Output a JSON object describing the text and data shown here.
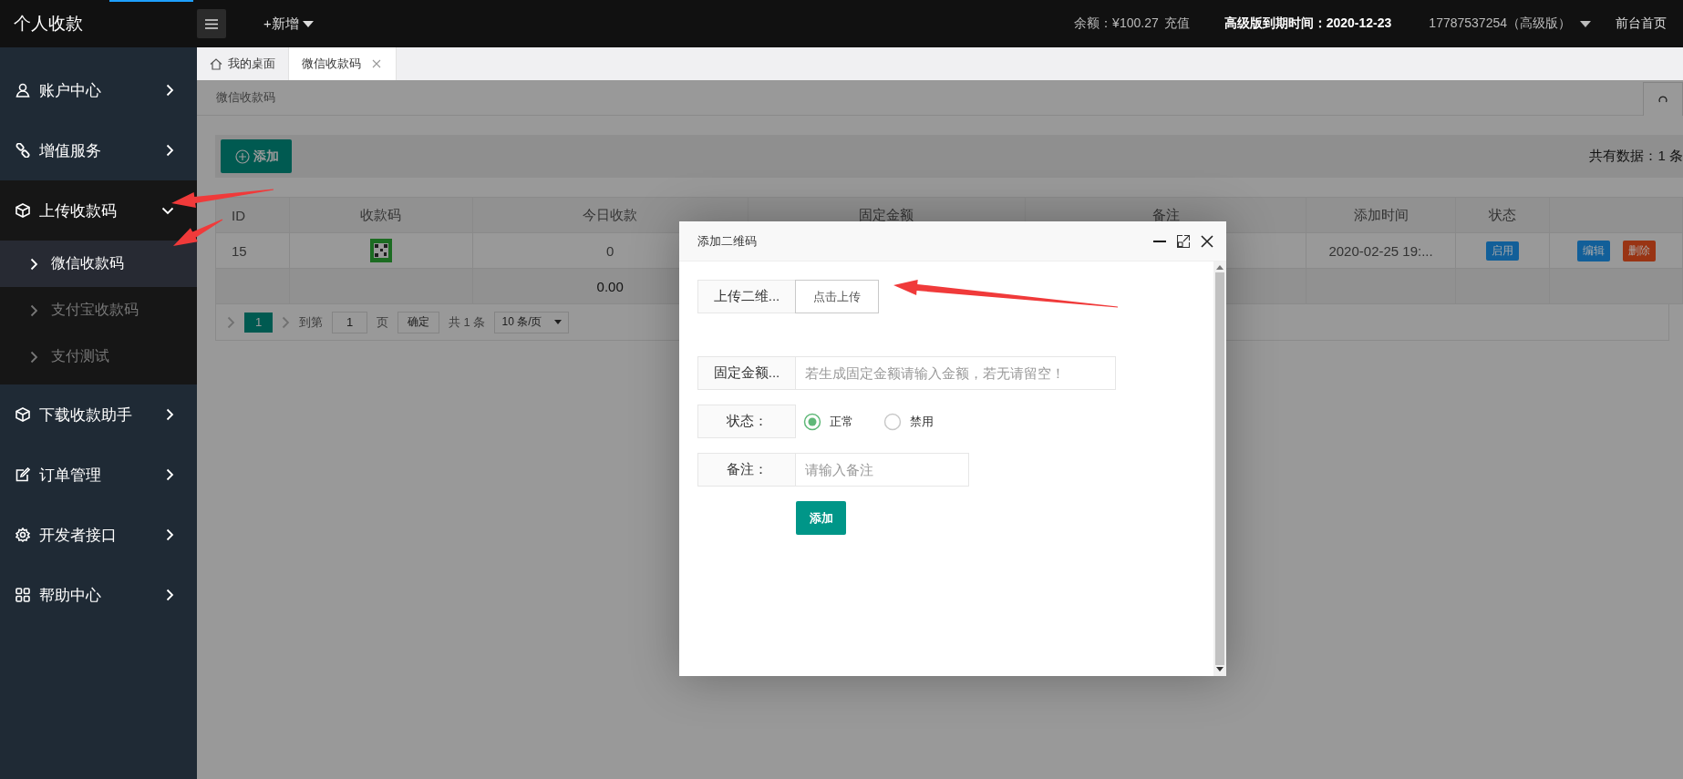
{
  "header": {
    "logo": "个人收款",
    "new_menu": "+新增",
    "balance": "余额：¥100.27",
    "recharge": "充值",
    "expiry": "高级版到期时间：2020-12-23",
    "user": "17787537254（高级版）",
    "front_page": "前台首页"
  },
  "sidebar": {
    "items": [
      {
        "label": "账户中心",
        "expanded": false
      },
      {
        "label": "增值服务",
        "expanded": false
      },
      {
        "label": "上传收款码",
        "expanded": true,
        "children": [
          {
            "label": "微信收款码",
            "selected": true
          },
          {
            "label": "支付宝收款码",
            "selected": false
          },
          {
            "label": "支付测试",
            "selected": false
          }
        ]
      },
      {
        "label": "下载收款助手",
        "expanded": false
      },
      {
        "label": "订单管理",
        "expanded": false
      },
      {
        "label": "开发者接口",
        "expanded": false
      },
      {
        "label": "帮助中心",
        "expanded": false
      }
    ]
  },
  "tabs": [
    {
      "kind": "home",
      "label": "我的桌面",
      "selected": false
    },
    {
      "kind": "page",
      "label": "微信收款码",
      "selected": true
    }
  ],
  "breadcrumb": "微信收款码",
  "toolbar": {
    "add_button": "添加",
    "total": "共有数据：1 条"
  },
  "table": {
    "columns": [
      "ID",
      "收款码",
      "今日收款",
      "固定金额",
      "备注",
      "添加时间",
      "状态"
    ],
    "rows": [
      {
        "kind": "data",
        "cells": [
          {
            "kind": "text",
            "text": "15"
          },
          {
            "kind": "qr"
          },
          {
            "kind": "text",
            "text": "0"
          },
          {
            "kind": "blank"
          },
          {
            "kind": "blank"
          },
          {
            "kind": "text",
            "text": "2020-02-25 19:..."
          },
          {
            "kind": "badge",
            "text": "启用",
            "color": "#125f99"
          },
          {
            "kind": "actions",
            "buttons": [
              {
                "label": "编辑",
                "color": "#125f99"
              },
              {
                "label": "删除",
                "color": "#993414"
              }
            ]
          }
        ]
      },
      {
        "kind": "total",
        "cells": [
          {
            "kind": "blank"
          },
          {
            "kind": "blank"
          },
          {
            "kind": "text",
            "text": "0.00"
          },
          {
            "kind": "blank"
          },
          {
            "kind": "blank"
          },
          {
            "kind": "blank"
          },
          {
            "kind": "blank"
          },
          {
            "kind": "blank"
          }
        ]
      }
    ]
  },
  "pager": {
    "current": "1",
    "goto_label": "到第",
    "page_input": "1",
    "page_unit": "页",
    "confirm": "确定",
    "total": "共 1 条",
    "page_size": "10 条/页"
  },
  "modal": {
    "title": "添加二维码",
    "fields": [
      {
        "kind": "upload",
        "label": "上传二维...",
        "button": "点击上传"
      },
      {
        "kind": "wide_input",
        "label": "固定金额...",
        "placeholder": "若生成固定金额请输入金额，若无请留空！"
      },
      {
        "kind": "radio",
        "label": "状态：",
        "options": [
          {
            "label": "正常",
            "selected": true
          },
          {
            "label": "禁用",
            "selected": false
          }
        ]
      },
      {
        "kind": "input",
        "label": "备注：",
        "placeholder": "请输入备注"
      }
    ],
    "submit": "添加"
  }
}
